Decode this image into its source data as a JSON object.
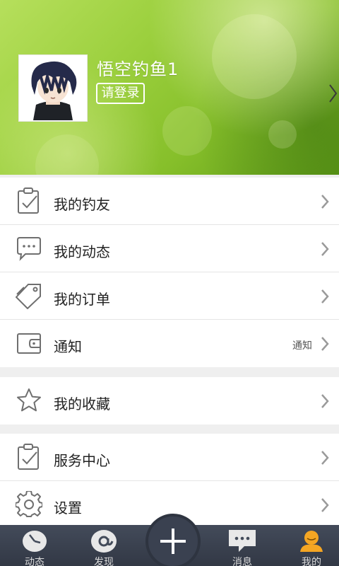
{
  "profile": {
    "username": "悟空钓鱼1",
    "login_label": "请登录"
  },
  "menu": {
    "group1": [
      {
        "label": "我的钓友",
        "icon": "clipboard-check-icon",
        "value": ""
      },
      {
        "label": "我的动态",
        "icon": "chat-bubble-icon",
        "value": ""
      },
      {
        "label": "我的订单",
        "icon": "tag-icon",
        "value": ""
      },
      {
        "label": "通知",
        "icon": "wallet-icon",
        "value": "通知"
      }
    ],
    "group2": [
      {
        "label": "我的收藏",
        "icon": "star-icon",
        "value": ""
      }
    ],
    "group3": [
      {
        "label": "服务中心",
        "icon": "clipboard-check-icon",
        "value": ""
      },
      {
        "label": "设置",
        "icon": "gear-icon",
        "value": ""
      }
    ]
  },
  "bottom_nav": {
    "items": [
      {
        "label": "动态",
        "icon": "clock-icon"
      },
      {
        "label": "发现",
        "icon": "at-icon"
      },
      {
        "label": "",
        "icon": "plus-icon"
      },
      {
        "label": "消息",
        "icon": "message-icon"
      },
      {
        "label": "我的",
        "icon": "person-icon",
        "active": true
      }
    ],
    "active_color": "#f5a623"
  },
  "colors": {
    "header_green": "#9cd03e",
    "nav_background": "#3a4150",
    "list_background": "#ffffff",
    "page_background": "#efefef"
  }
}
